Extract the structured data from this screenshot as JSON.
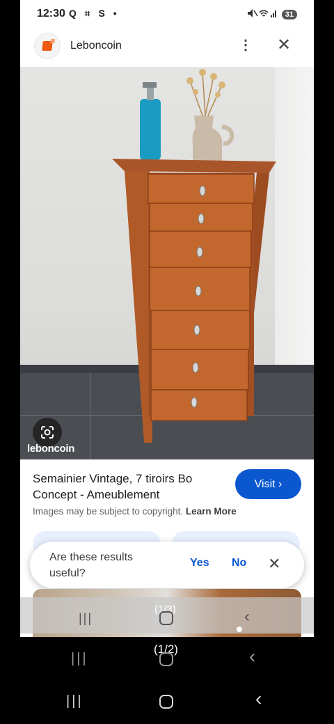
{
  "status_bar": {
    "time": "12:30",
    "left_icons": "Q ⌗ S •",
    "right_icons": "🔇 📶",
    "battery": "31"
  },
  "header": {
    "site_name": "Leboncoin",
    "menu_icon": "⋮",
    "close_icon": "✕",
    "logo_color": "#ec5a13"
  },
  "image": {
    "watermark": "leboncoin"
  },
  "result": {
    "title": "Semainier Vintage, 7 tiroirs Bo Concept - Ameublement",
    "visit_label": "Visit ›",
    "copyright_text": "Images may be subject to copyright.",
    "learn_more": "Learn More",
    "accent_color": "#0b57d0"
  },
  "feedback": {
    "question": "Are these results useful?",
    "yes": "Yes",
    "no": "No",
    "close": "✕"
  },
  "inner_nav": {
    "counter": "(1/3)",
    "recent_icon": "|||",
    "back_icon": "‹"
  },
  "outer_nav": {
    "counter": "(1/2)",
    "recent_icon": "|||",
    "back_icon": "‹"
  }
}
